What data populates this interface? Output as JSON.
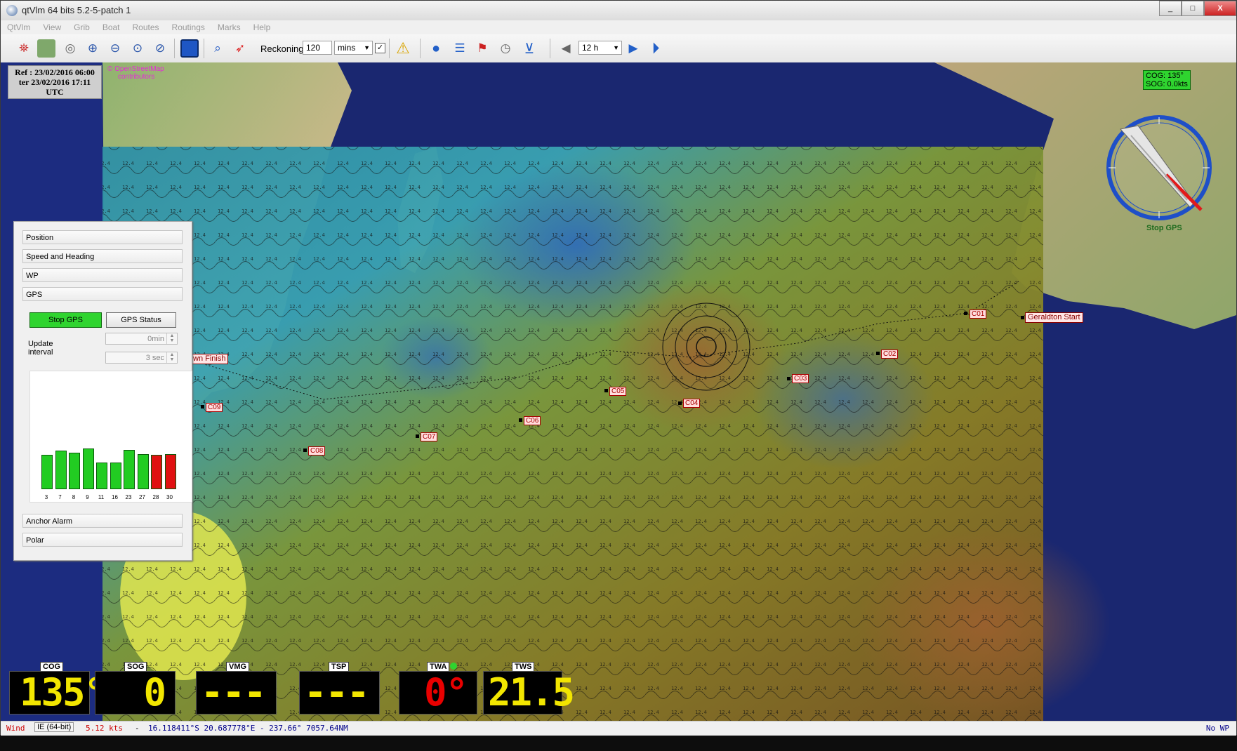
{
  "window": {
    "title": "qtVlm 64 bits 5.2-5-patch 1",
    "min": "_",
    "max": "□",
    "close": "X"
  },
  "menu": [
    "QtVlm",
    "View",
    "Grib",
    "Boat",
    "Routes",
    "Routings",
    "Marks",
    "Help"
  ],
  "toolbar": {
    "reckoning_label": "Reckoning",
    "reckoning_value": "120",
    "reckoning_unit": "mins",
    "reckoning_checked": "✓",
    "time_step": "12 h"
  },
  "ref_box": {
    "line1": "Ref : 23/02/2016 06:00",
    "line2": "ter 23/02/2016 17:11",
    "line3": "UTC"
  },
  "osm": {
    "line1": "© OpenStreetMap",
    "line2": "contributors"
  },
  "cog_readout": {
    "cog": "COG: 135°",
    "sog": "SOG: 0.0kts"
  },
  "compass": {
    "stop_gps": "Stop GPS"
  },
  "waypoints": [
    "C01",
    "C02",
    "C03",
    "C04",
    "C05",
    "C06",
    "C07",
    "C08",
    "C09"
  ],
  "route": {
    "start": "Geraldton Start",
    "finish": "wn Finish"
  },
  "panel": {
    "sections": [
      "Position",
      "Speed and Heading",
      "WP",
      "GPS"
    ],
    "stop_gps": "Stop GPS",
    "gps_status": "GPS Status",
    "update_interval_l1": "Update",
    "update_interval_l2": "interval",
    "interval_min": "0min",
    "interval_sec": "3 sec",
    "bars": [
      {
        "label": "3",
        "level": 0.62,
        "color": "#22cc22"
      },
      {
        "label": "7",
        "level": 0.7,
        "color": "#22cc22"
      },
      {
        "label": "8",
        "level": 0.66,
        "color": "#22cc22"
      },
      {
        "label": "9",
        "level": 0.74,
        "color": "#22cc22"
      },
      {
        "label": "11",
        "level": 0.48,
        "color": "#22cc22"
      },
      {
        "label": "16",
        "level": 0.48,
        "color": "#22cc22"
      },
      {
        "label": "23",
        "level": 0.72,
        "color": "#22cc22"
      },
      {
        "label": "27",
        "level": 0.64,
        "color": "#22cc22"
      },
      {
        "label": "28",
        "level": 0.62,
        "color": "#e01010"
      },
      {
        "label": "30",
        "level": 0.64,
        "color": "#e01010"
      }
    ],
    "anchor_alarm": "Anchor Alarm",
    "polar": "Polar"
  },
  "gauges": {
    "cog": {
      "label": "COG",
      "value": "135°"
    },
    "sog": {
      "label": "SOG",
      "value": "0"
    },
    "vmg": {
      "label": "VMG",
      "value": "----"
    },
    "tsp": {
      "label": "TSP",
      "value": "----"
    },
    "twa": {
      "label": "TWA",
      "value": "0°"
    },
    "tws": {
      "label": "TWS",
      "value": "21.5"
    }
  },
  "statusbar": {
    "wind": "Wind",
    "speed": "5.12 kts",
    "dash": "-",
    "position": "16.118411°S 20.687778°E - 237.66° 7057.64NM",
    "taskbar": "IE (64-bit)",
    "no_wp": "No WP"
  }
}
